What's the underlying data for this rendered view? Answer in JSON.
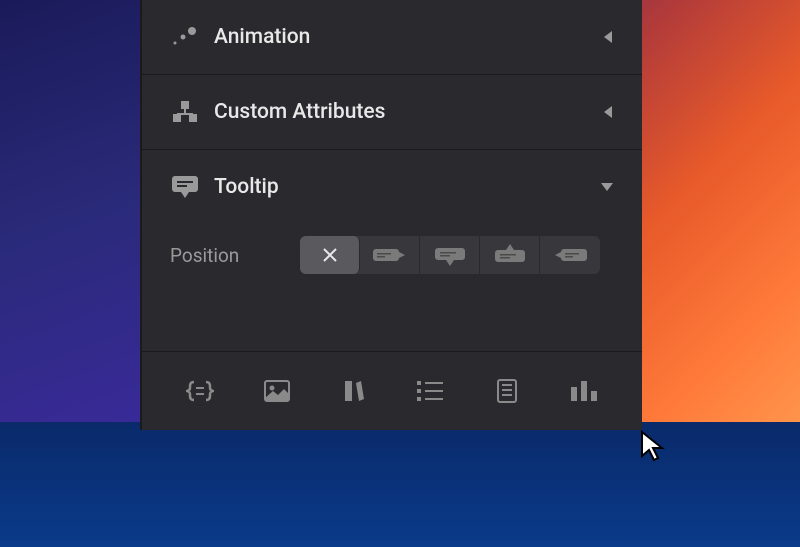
{
  "sections": {
    "animation": {
      "label": "Animation",
      "expanded": false
    },
    "custom_attributes": {
      "label": "Custom Attributes",
      "expanded": false
    },
    "tooltip": {
      "label": "Tooltip",
      "expanded": true
    }
  },
  "tooltip": {
    "position_label": "Position",
    "position_options": [
      "none",
      "right",
      "bottom",
      "top",
      "left"
    ],
    "position_selected": "none"
  },
  "footer_tabs": [
    "code",
    "image",
    "style",
    "list",
    "document",
    "columns"
  ]
}
